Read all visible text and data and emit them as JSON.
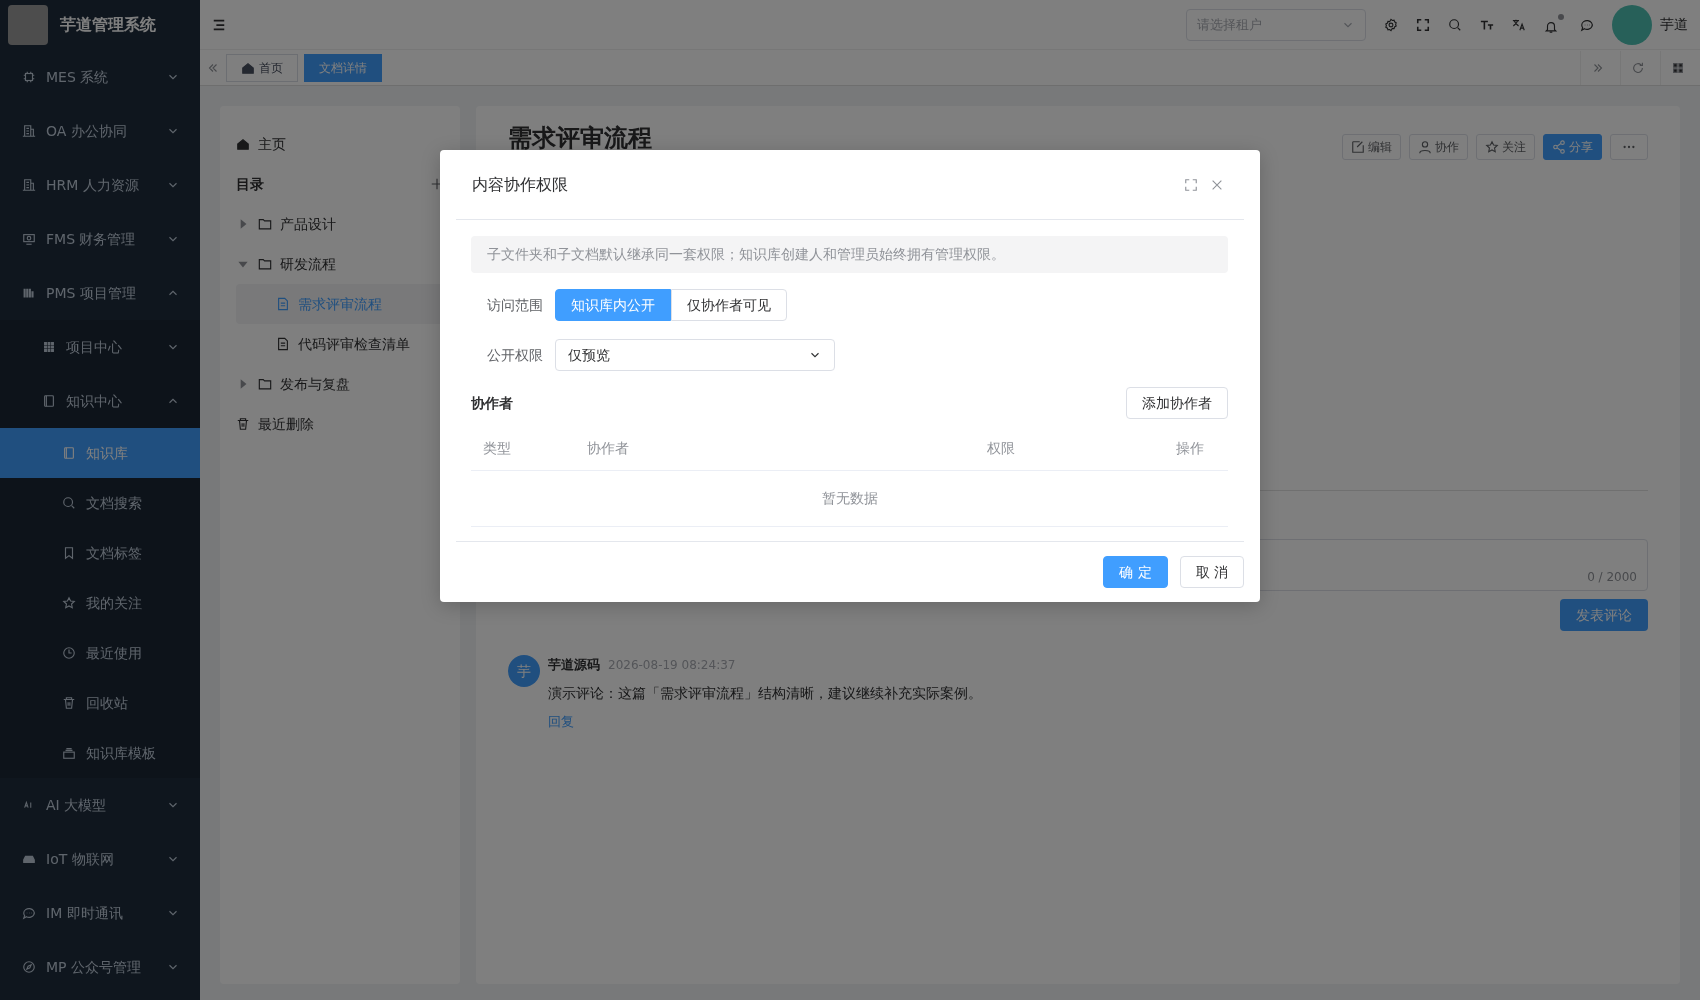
{
  "app": {
    "title": "芋道管理系统"
  },
  "sidebar": {
    "items": [
      {
        "label": "MES 系统",
        "expanded": false
      },
      {
        "label": "OA 办公协同",
        "expanded": false
      },
      {
        "label": "HRM 人力资源",
        "expanded": false
      },
      {
        "label": "FMS 财务管理",
        "expanded": false
      },
      {
        "label": "PMS 项目管理",
        "expanded": true,
        "children": [
          {
            "label": "项目中心",
            "expanded": false
          },
          {
            "label": "知识中心",
            "expanded": true,
            "children": [
              {
                "label": "知识库",
                "selected": true
              },
              {
                "label": "文档搜索",
                "selected": false
              },
              {
                "label": "文档标签",
                "selected": false
              },
              {
                "label": "我的关注",
                "selected": false
              },
              {
                "label": "最近使用",
                "selected": false
              },
              {
                "label": "回收站",
                "selected": false
              },
              {
                "label": "知识库模板",
                "selected": false
              }
            ]
          }
        ]
      },
      {
        "label": "AI 大模型",
        "expanded": false
      },
      {
        "label": "IoT 物联网",
        "expanded": false
      },
      {
        "label": "IM 即时通讯",
        "expanded": false
      },
      {
        "label": "MP 公众号管理",
        "expanded": false
      }
    ]
  },
  "header": {
    "tenant_select": {
      "placeholder": "请选择租户"
    },
    "notification_dot": true,
    "user": "芋道"
  },
  "tabs": [
    {
      "label": "首页",
      "selected": false
    },
    {
      "label": "文档详情",
      "selected": true
    }
  ],
  "doc_tree": {
    "home": "主页",
    "catalog": "目录",
    "nodes": [
      {
        "label": "产品设计",
        "kind": "folder",
        "expanded": false
      },
      {
        "label": "研发流程",
        "kind": "folder",
        "expanded": true,
        "children": [
          {
            "label": "需求评审流程",
            "kind": "doc",
            "selected": true
          },
          {
            "label": "代码评审检查清单",
            "kind": "doc",
            "selected": false
          }
        ]
      },
      {
        "label": "发布与复盘",
        "kind": "folder",
        "expanded": false
      }
    ],
    "trash": "最近删除"
  },
  "document": {
    "title": "需求评审流程",
    "actions": [
      {
        "label": "编辑",
        "primary": false
      },
      {
        "label": "协作",
        "primary": false
      },
      {
        "label": "关注",
        "primary": false
      },
      {
        "label": "分享",
        "primary": true
      }
    ],
    "comment_box": {
      "counter": "0 / 2000",
      "submit": "发表评论"
    },
    "comments": [
      {
        "avatar": "芋",
        "author": "芋道源码",
        "time": "2026-08-19 08:24:37",
        "text": "演示评论：这篇「需求评审流程」结构清晰，建议继续补充实际案例。",
        "reply": "回复"
      }
    ]
  },
  "dialog": {
    "title": "内容协作权限",
    "hint": "子文件夹和子文档默认继承同一套权限；知识库创建人和管理员始终拥有管理权限。",
    "access_scope": {
      "label": "访问范围",
      "options": [
        {
          "label": "知识库内公开",
          "selected": true
        },
        {
          "label": "仅协作者可见",
          "selected": false
        }
      ]
    },
    "public_permission": {
      "label": "公开权限",
      "value": "仅预览"
    },
    "collaborators": {
      "heading": "协作者",
      "add_button": "添加协作者",
      "columns": [
        "类型",
        "协作者",
        "权限",
        "操作"
      ],
      "empty_text": "暂无数据"
    },
    "buttons": [
      {
        "label": "确 定",
        "primary": true
      },
      {
        "label": "取 消",
        "primary": false
      }
    ]
  }
}
